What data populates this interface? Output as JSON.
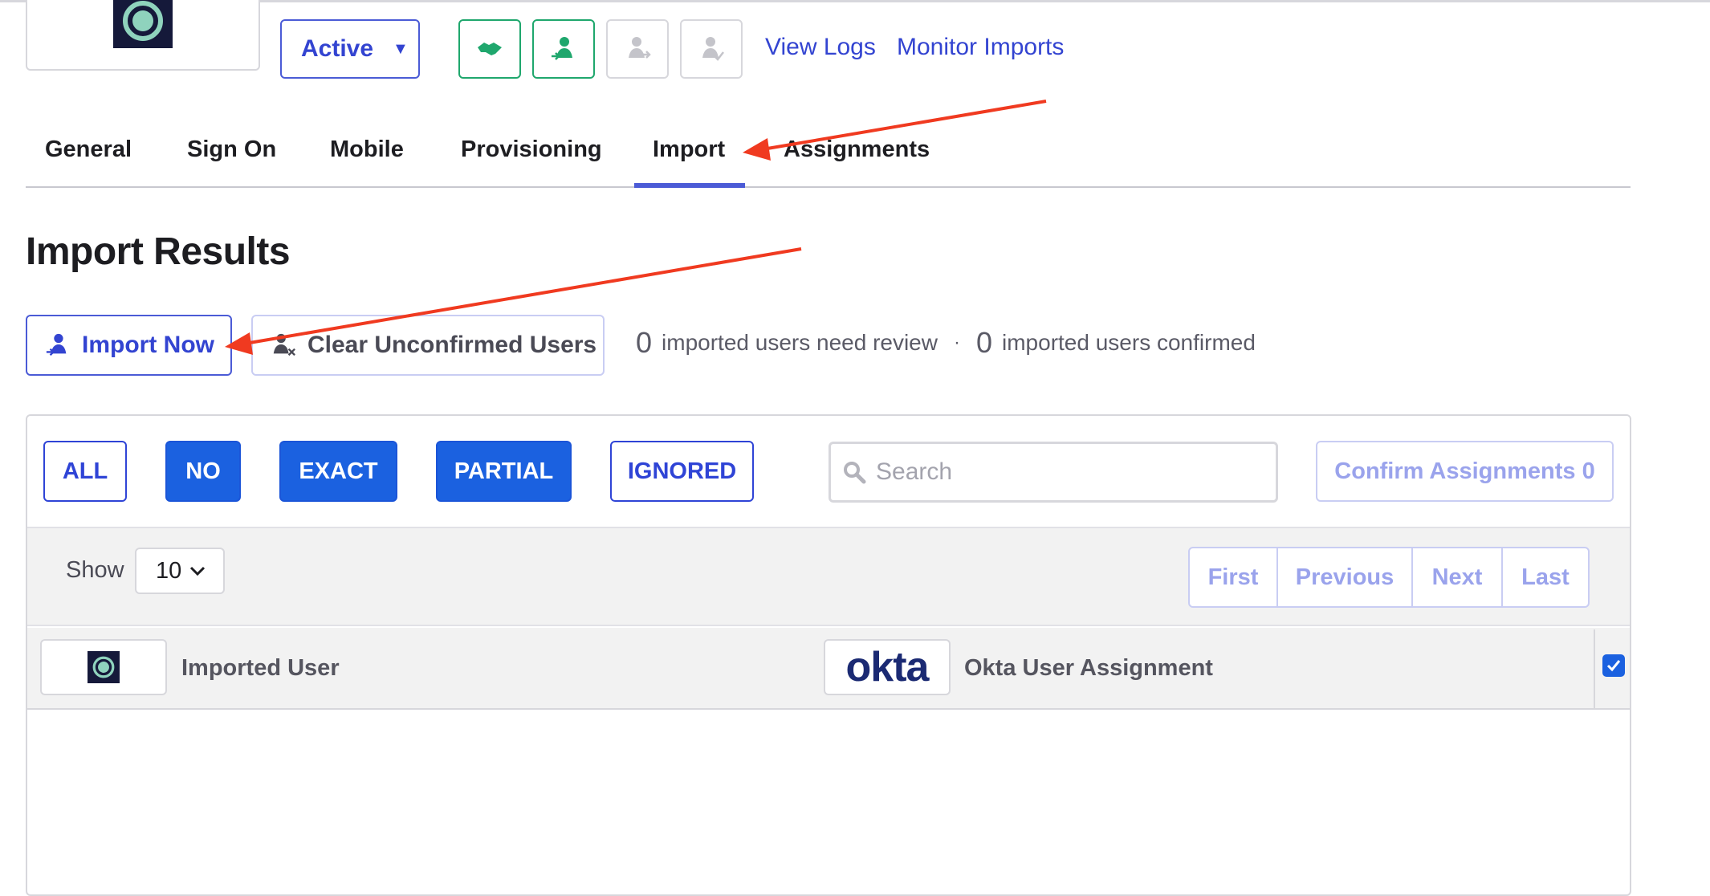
{
  "header": {
    "status_label": "Active",
    "links": {
      "view_logs": "View Logs",
      "monitor_imports": "Monitor Imports"
    },
    "icon_buttons": [
      "handshake-icon",
      "push-user-icon",
      "user-push-disabled-icon",
      "user-confirm-disabled-icon"
    ]
  },
  "tabs": [
    {
      "label": "General"
    },
    {
      "label": "Sign On"
    },
    {
      "label": "Mobile"
    },
    {
      "label": "Provisioning"
    },
    {
      "label": "Import",
      "active": true
    },
    {
      "label": "Assignments"
    }
  ],
  "section": {
    "title": "Import Results",
    "import_now": "Import Now",
    "clear_unconfirmed": "Clear Unconfirmed Users",
    "counts": {
      "need_review": "0",
      "need_review_label": "imported users need review",
      "separator": "·",
      "confirmed": "0",
      "confirmed_label": "imported users confirmed"
    }
  },
  "filters": [
    {
      "label": "ALL",
      "selected": false
    },
    {
      "label": "NO",
      "selected": true
    },
    {
      "label": "EXACT",
      "selected": true
    },
    {
      "label": "PARTIAL",
      "selected": true
    },
    {
      "label": "IGNORED",
      "selected": false
    }
  ],
  "search": {
    "placeholder": "Search"
  },
  "confirm_assignments": "Confirm Assignments 0",
  "table": {
    "show_label": "Show",
    "page_size": "10",
    "pager": [
      "First",
      "Previous",
      "Next",
      "Last"
    ],
    "columns": {
      "imported_user": "Imported User",
      "okta_logo_text": "okta",
      "okta_assignment": "Okta User Assignment"
    },
    "select_all_checked": true
  },
  "colors": {
    "accent": "#4b5bd6",
    "primary_fill": "#1b61e0",
    "success": "#1fa76d",
    "annotation_arrow": "#f03a20"
  }
}
